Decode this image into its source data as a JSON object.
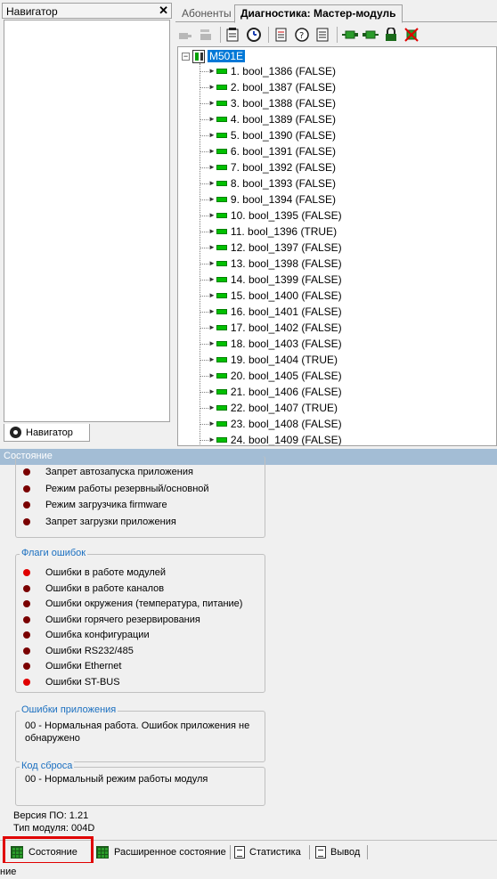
{
  "navigator": {
    "title": "Навигатор",
    "close": "✕",
    "tab_label": "Навигатор"
  },
  "tabs": [
    {
      "label": "Абоненты"
    },
    {
      "label": "Диагностика: Мастер-модуль"
    }
  ],
  "tree": {
    "root_label": "M501E",
    "expander": "−",
    "items": [
      {
        "label": "1. bool_1386 (FALSE)"
      },
      {
        "label": "2. bool_1387 (FALSE)"
      },
      {
        "label": "3. bool_1388 (FALSE)"
      },
      {
        "label": "4. bool_1389 (FALSE)"
      },
      {
        "label": "5. bool_1390 (FALSE)"
      },
      {
        "label": "6. bool_1391 (FALSE)"
      },
      {
        "label": "7. bool_1392 (FALSE)"
      },
      {
        "label": "8. bool_1393 (FALSE)"
      },
      {
        "label": "9. bool_1394 (FALSE)"
      },
      {
        "label": "10. bool_1395 (FALSE)"
      },
      {
        "label": "11. bool_1396 (TRUE)"
      },
      {
        "label": "12. bool_1397 (FALSE)"
      },
      {
        "label": "13. bool_1398 (FALSE)"
      },
      {
        "label": "14. bool_1399 (FALSE)"
      },
      {
        "label": "15. bool_1400 (FALSE)"
      },
      {
        "label": "16. bool_1401 (FALSE)"
      },
      {
        "label": "17. bool_1402 (FALSE)"
      },
      {
        "label": "18. bool_1403 (FALSE)"
      },
      {
        "label": "19. bool_1404 (TRUE)"
      },
      {
        "label": "20. bool_1405 (FALSE)"
      },
      {
        "label": "21. bool_1406 (FALSE)"
      },
      {
        "label": "22. bool_1407 (TRUE)"
      },
      {
        "label": "23. bool_1408 (FALSE)"
      },
      {
        "label": "24. bool_1409 (FALSE)"
      }
    ]
  },
  "status": {
    "header": "Состояние",
    "mode_flags": [
      {
        "label": "Запрет автозапуска приложения",
        "color": "#7a0000"
      },
      {
        "label": "Режим работы резервный/основной",
        "color": "#7a0000"
      },
      {
        "label": "Режим загрузчика firmware",
        "color": "#7a0000"
      },
      {
        "label": "Запрет загрузки приложения",
        "color": "#7a0000"
      }
    ],
    "error_flags_title": "Флаги ошибок",
    "error_flags": [
      {
        "label": "Ошибки в работе модулей",
        "color": "#e00000"
      },
      {
        "label": "Ошибки в работе каналов",
        "color": "#7a0000"
      },
      {
        "label": "Ошибки окружения (температура, питание)",
        "color": "#7a0000"
      },
      {
        "label": "Ошибки горячего резервирования",
        "color": "#7a0000"
      },
      {
        "label": "Ошибка конфигурации",
        "color": "#7a0000"
      },
      {
        "label": "Ошибки RS232/485",
        "color": "#7a0000"
      },
      {
        "label": "Ошибки Ethernet",
        "color": "#7a0000"
      },
      {
        "label": "Ошибки ST-BUS",
        "color": "#e00000"
      }
    ],
    "app_errors_title": "Ошибки приложения",
    "app_errors_text": "00 - Нормальная работа. Ошибок приложения не обнаружено",
    "reset_code_title": "Код сброса",
    "reset_code_text": "00 - Нормальный режим работы модуля",
    "version_line": "Версия ПО:  1.21",
    "module_type_line": "Тип модуля:   004D"
  },
  "bottom_tabs": [
    {
      "label": "Состояние"
    },
    {
      "label": "Расширенное состояние"
    },
    {
      "label": "Статистика"
    },
    {
      "label": "Вывод"
    }
  ],
  "statusbar_text": "ние"
}
